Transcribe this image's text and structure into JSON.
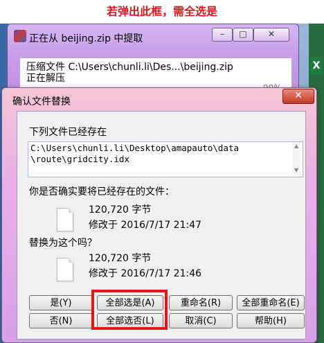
{
  "annotation": "若弹出此框，需全选是",
  "back_window": {
    "title": "正在从 beijing.zip 中提取",
    "line1": "压缩文件 C:\\Users\\chunli.li\\Des...\\beijing.zip",
    "line2": "正在解压",
    "percent": "99%"
  },
  "dialog": {
    "title": "确认文件替换",
    "close_label": "✕",
    "exists_label": "下列文件已经存在",
    "path_line1": "C:\\Users\\chunli.li\\Desktop\\amapauto\\data",
    "path_line2": "\\route\\gridcity.idx",
    "question": "你是否确实要将已经存在的文件：",
    "existing_size": "120,720 字节",
    "existing_modified": "修改于 2016/7/17 21:47",
    "replace_question": "替换为这个吗？",
    "new_size": "120,720 字节",
    "new_modified": "修改于 2016/7/17 21:46"
  },
  "buttons": {
    "yes": "是(Y)",
    "yes_all": "全部选是(A)",
    "rename": "重命名(R)",
    "rename_all": "全部重命名(E)",
    "no": "否(N)",
    "no_all": "全部选否(L)",
    "cancel": "取消(C)",
    "help": "帮助(H)"
  },
  "colors": {
    "highlight": "#e8141b",
    "annotation": "#e0161d"
  }
}
